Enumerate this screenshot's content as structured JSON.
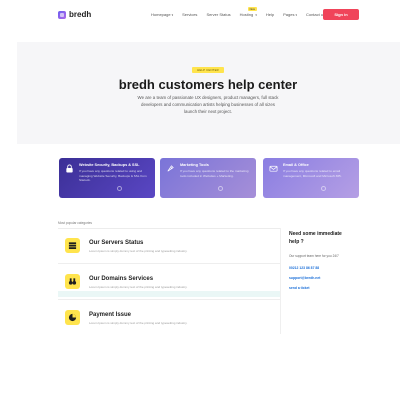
{
  "brand": {
    "name": "bredh"
  },
  "nav": {
    "items": [
      "Homepage",
      "Services",
      "Server Status",
      "Hosting",
      "Help",
      "Pages",
      "Contact us"
    ],
    "new_badge": "New",
    "signin": "Sign in"
  },
  "hero": {
    "badge": "HELP CENTER",
    "title": "bredh customers help center",
    "subtitle": "We are a team of passionate UX designers, product managers, full stack developers and communication artists helping businesses of all sizes launch their next project."
  },
  "cards": [
    {
      "title": "Website Security, Backups & SSL",
      "desc": "If you have any questions related to using and managing Website Security, Backups & SSL from Sitelock.",
      "icon": "lock-icon"
    },
    {
      "title": "Marketing Tools",
      "desc": "If you have any questions related to the marketing tools included in Websites + Marketing.",
      "icon": "rocket-icon"
    },
    {
      "title": "Email & Office",
      "desc": "If you have any questions related to email management, Microsoft and Microsoft 365.",
      "icon": "envelope-icon"
    }
  ],
  "categories": {
    "label": "Most popular categories",
    "items": [
      {
        "title": "Our Servers Status",
        "desc": "Lorem Ipsum is simply dummy text of the printing and typesetting industry.",
        "icon": "server-icon"
      },
      {
        "title": "Our Domains Services",
        "desc": "Lorem Ipsum is simply dummy text of the printing and typesetting industry.",
        "icon": "binoculars-icon"
      },
      {
        "title": "Payment Issue",
        "desc": "Lorem Ipsum is simply dummy text of the printing and typesetting industry.",
        "icon": "chart-pie-icon"
      }
    ]
  },
  "side": {
    "title": "Need some immediate help ?",
    "text": "Our support team here for you 24/7",
    "phone": "00212 123 86 87 88",
    "email": "support@bredh.net",
    "ticket": "send a ticket"
  },
  "colors": {
    "accent": "#f0445a",
    "badge": "#ffe44d",
    "link": "#1b6fd8"
  }
}
